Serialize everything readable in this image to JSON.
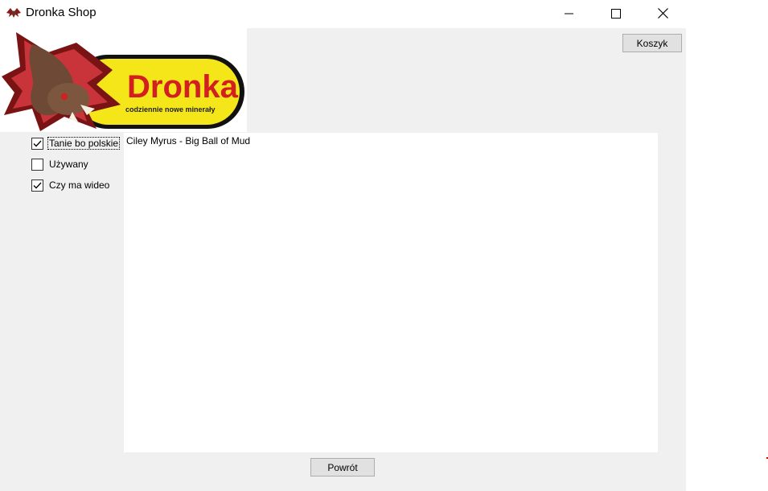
{
  "window": {
    "title": "Dronka Shop",
    "controls": [
      "minimize",
      "maximize",
      "close"
    ]
  },
  "logo": {
    "brand": "Dronka",
    "tagline": "codziennie nowe minerały",
    "icon": "dragon-mascot"
  },
  "toolbar": {
    "cart_label": "Koszyk"
  },
  "filters": [
    {
      "label": "Tanie bo polskie",
      "checked": true
    },
    {
      "label": "Używany",
      "checked": false
    },
    {
      "label": "Czy ma wideo",
      "checked": true
    }
  ],
  "list": {
    "items": [
      "Ciley Myrus - Big Ball of Mud"
    ]
  },
  "footer": {
    "back_label": "Powrót"
  },
  "colors": {
    "window_bg": "#f0f0f0",
    "button_bg": "#e1e1e1",
    "button_border": "#adadad",
    "logo_yellow": "#f4e619",
    "logo_red": "#d21f1f"
  }
}
